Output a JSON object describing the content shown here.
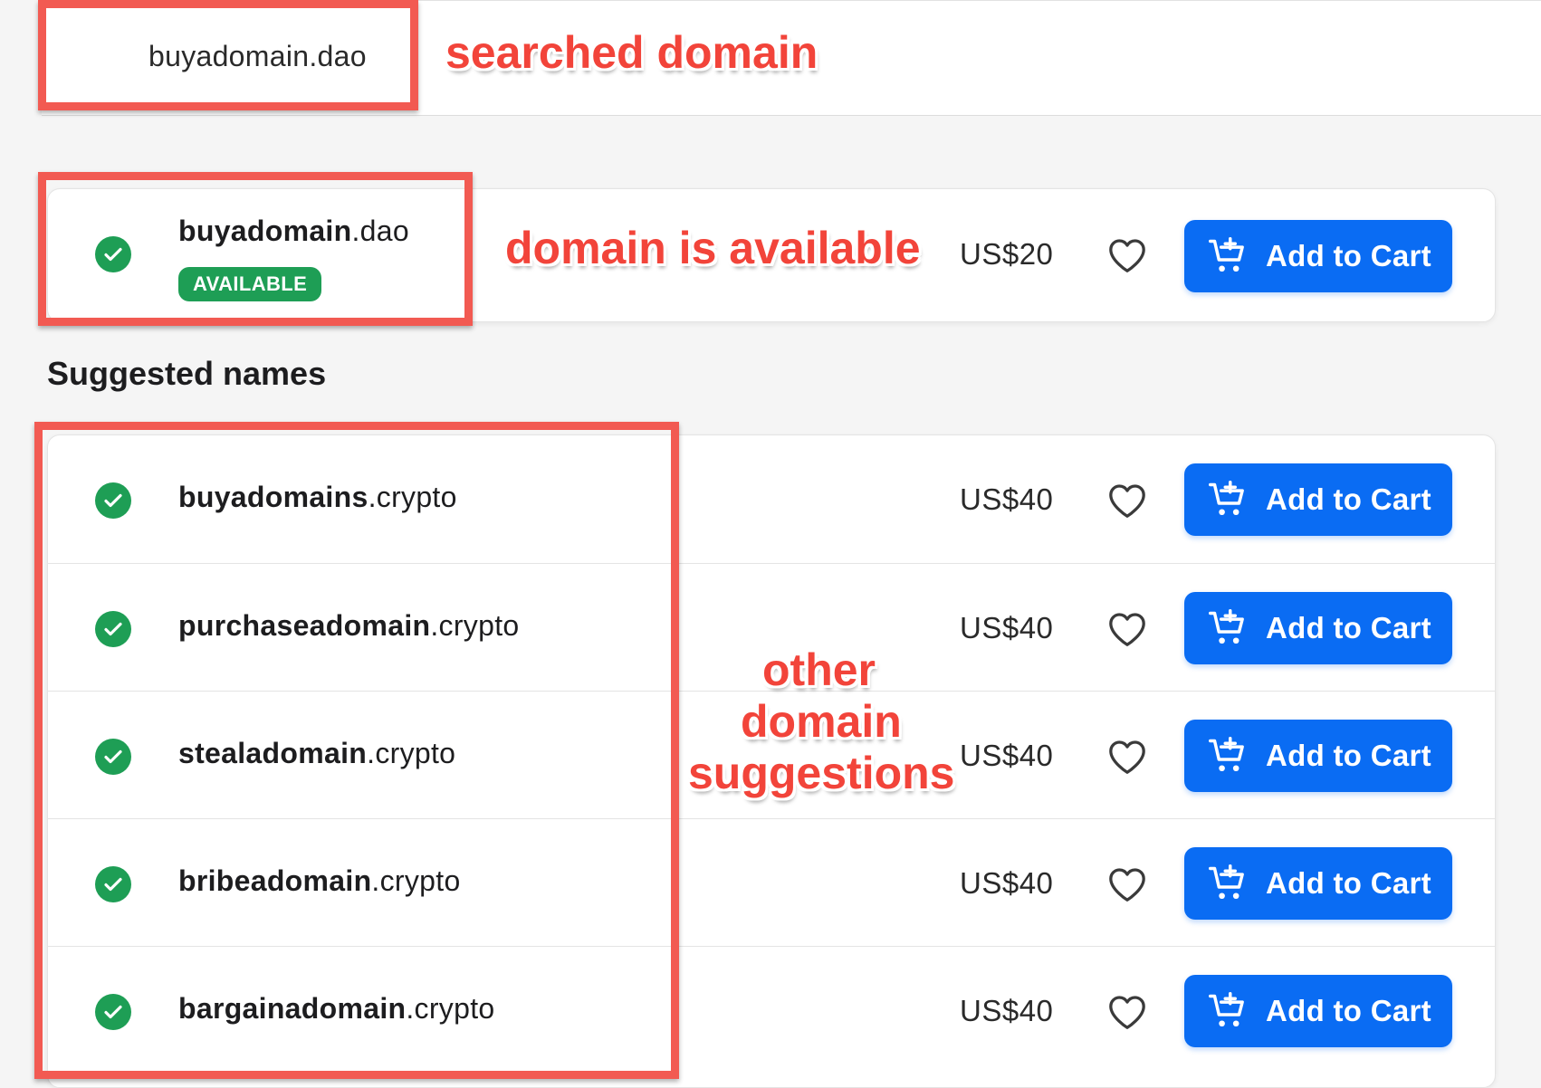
{
  "search": {
    "value": "buyadomain.dao"
  },
  "featured": {
    "name": "buyadomain",
    "tld": ".dao",
    "badge": "AVAILABLE",
    "price": "US$20",
    "cart_label": "Add to Cart"
  },
  "section_title": "Suggested names",
  "suggestions": [
    {
      "name": "buyadomains",
      "tld": ".crypto",
      "price": "US$40",
      "cart_label": "Add to Cart"
    },
    {
      "name": "purchaseadomain",
      "tld": ".crypto",
      "price": "US$40",
      "cart_label": "Add to Cart"
    },
    {
      "name": "stealadomain",
      "tld": ".crypto",
      "price": "US$40",
      "cart_label": "Add to Cart"
    },
    {
      "name": "bribeadomain",
      "tld": ".crypto",
      "price": "US$40",
      "cart_label": "Add to Cart"
    },
    {
      "name": "bargainadomain",
      "tld": ".crypto",
      "price": "US$40",
      "cart_label": "Add to Cart"
    }
  ],
  "annotations": {
    "searched": "searched domain",
    "available": "domain is available",
    "other_line1": "other",
    "other_line2": "domain",
    "other_line3": "suggestions"
  },
  "colors": {
    "accent": "#0a6cf3",
    "available_green": "#1e9e55",
    "annotation_red": "#f25a52"
  },
  "icons": {
    "status": "check-circle-icon",
    "favorite": "heart-icon",
    "cart": "cart-plus-icon"
  }
}
